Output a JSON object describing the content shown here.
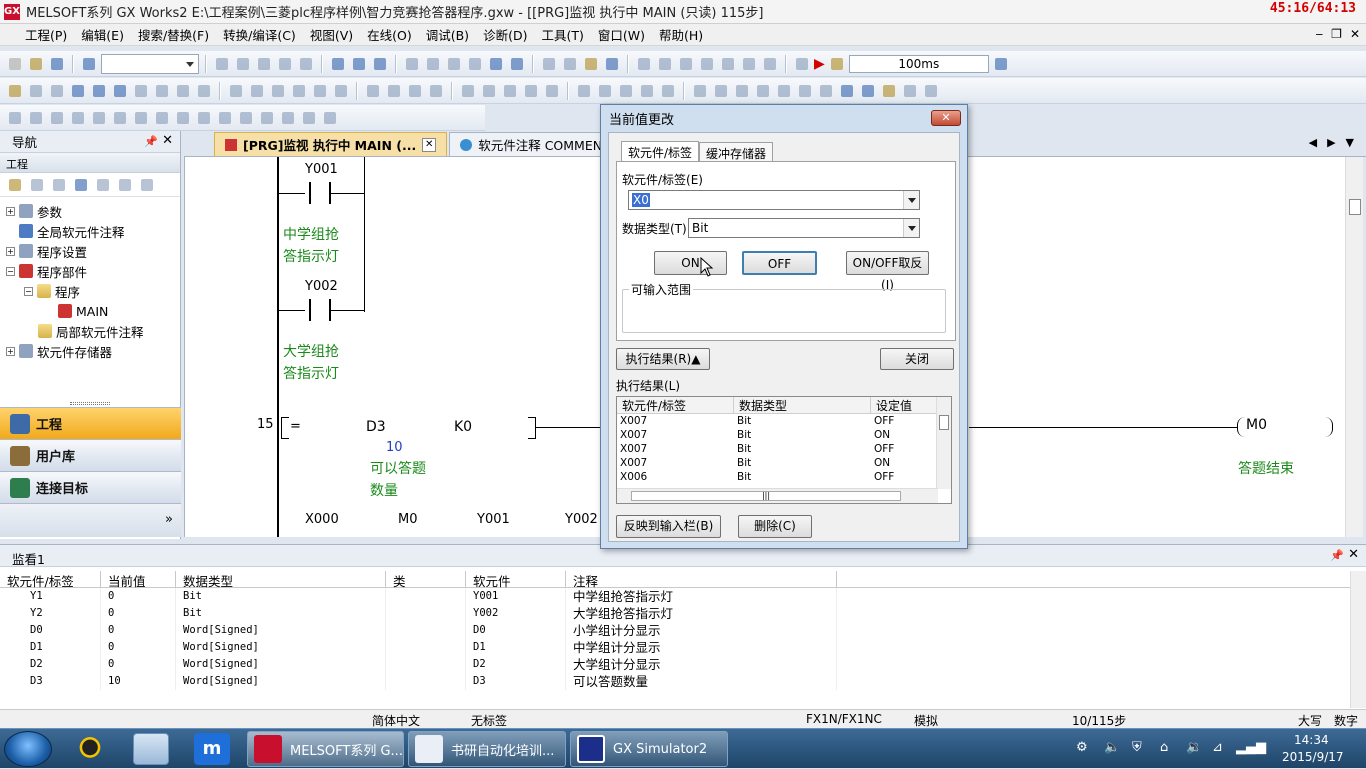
{
  "titlebar": {
    "title": "MELSOFT系列 GX Works2 E:\\工程案例\\三菱plc程序样例\\智力竞赛抢答器程序.gxw - [[PRG]监视 执行中 MAIN (只读) 115步]",
    "clock": "45:16/64:13"
  },
  "menubar": {
    "items": [
      "工程(P)",
      "编辑(E)",
      "搜索/替换(F)",
      "转换/编译(C)",
      "视图(V)",
      "在线(O)",
      "调试(B)",
      "诊断(D)",
      "工具(T)",
      "窗口(W)",
      "帮助(H)"
    ]
  },
  "toolbar": {
    "scan_time": "100ms"
  },
  "nav": {
    "title": "导航",
    "subheader": "工程",
    "tree": [
      {
        "label": "参数",
        "indent": 0,
        "exp": "+"
      },
      {
        "label": "全局软元件注释",
        "indent": 0,
        "exp": ""
      },
      {
        "label": "程序设置",
        "indent": 0,
        "exp": "+"
      },
      {
        "label": "程序部件",
        "indent": 0,
        "exp": "-"
      },
      {
        "label": "程序",
        "indent": 1,
        "exp": "-"
      },
      {
        "label": "MAIN",
        "indent": 2,
        "exp": ""
      },
      {
        "label": "局部软元件注释",
        "indent": 1,
        "exp": ""
      },
      {
        "label": "软元件存储器",
        "indent": 0,
        "exp": "+"
      }
    ],
    "tabs": [
      "工程",
      "用户库",
      "连接目标"
    ]
  },
  "doctabs": {
    "tab1": "[PRG]监视 执行中 MAIN (...",
    "tab2": "软元件注释 COMMENT"
  },
  "ladder": {
    "contact_y001": "Y001",
    "comment_y001_1": "中学组抢",
    "comment_y001_2": "答指示灯",
    "contact_y002": "Y002",
    "comment_y002_1": "大学组抢",
    "comment_y002_2": "答指示灯",
    "step": "15",
    "cmp_op": "=",
    "cmp_d3": "D3",
    "cmp_d3_value": "10",
    "cmp_k0": "K0",
    "d3_comment_1": "可以答题",
    "d3_comment_2": "数量",
    "coil": "M0",
    "coil_comment": "答题结束",
    "bottom_x000": "X000",
    "bottom_m0": "M0",
    "bottom_y001": "Y001",
    "bottom_y002": "Y002"
  },
  "dialog": {
    "title": "当前值更改",
    "tab_device": "软元件/标签",
    "tab_buffer": "缓冲存储器",
    "device_label": "软元件/标签(E)",
    "device_value": "X0",
    "datatype_label": "数据类型(T)",
    "datatype_value": "Bit",
    "btn_on": "ON",
    "btn_off": "OFF",
    "btn_toggle": "ON/OFF取反(I)",
    "range_label": "可输入范围",
    "btn_result": "执行结果(R)▲",
    "btn_close": "关闭",
    "result_label": "执行结果(L)",
    "result_headers": [
      "软元件/标签",
      "数据类型",
      "设定值"
    ],
    "result_rows": [
      [
        "X007",
        "Bit",
        "OFF"
      ],
      [
        "X007",
        "Bit",
        "ON"
      ],
      [
        "X007",
        "Bit",
        "OFF"
      ],
      [
        "X007",
        "Bit",
        "ON"
      ],
      [
        "X006",
        "Bit",
        "OFF"
      ]
    ],
    "btn_reflect": "反映到输入栏(B)",
    "btn_delete": "删除(C)"
  },
  "watch": {
    "title": "监看1",
    "headers": [
      "软元件/标签",
      "当前值",
      "数据类型",
      "类",
      "软元件",
      "注释"
    ],
    "rows": [
      [
        "Y1",
        "0",
        "Bit",
        "",
        "Y001",
        "中学组抢答指示灯"
      ],
      [
        "Y2",
        "0",
        "Bit",
        "",
        "Y002",
        "大学组抢答指示灯"
      ],
      [
        "D0",
        "0",
        "Word[Signed]",
        "",
        "D0",
        "小学组计分显示"
      ],
      [
        "D1",
        "0",
        "Word[Signed]",
        "",
        "D1",
        "中学组计分显示"
      ],
      [
        "D2",
        "0",
        "Word[Signed]",
        "",
        "D2",
        "大学组计分显示"
      ],
      [
        "D3",
        "10",
        "Word[Signed]",
        "",
        "D3",
        "可以答题数量"
      ]
    ]
  },
  "status": {
    "lang": "简体中文",
    "label": "无标签",
    "plc": "FX1N/FX1NC",
    "mode": "模拟",
    "steps": "10/115步",
    "caps": "大写",
    "num": "数字"
  },
  "taskbar": {
    "btn1": "MELSOFT系列 G...",
    "btn2": "书研自动化培训...",
    "btn3": "GX Simulator2",
    "time": "14:34",
    "date": "2015/9/17"
  }
}
